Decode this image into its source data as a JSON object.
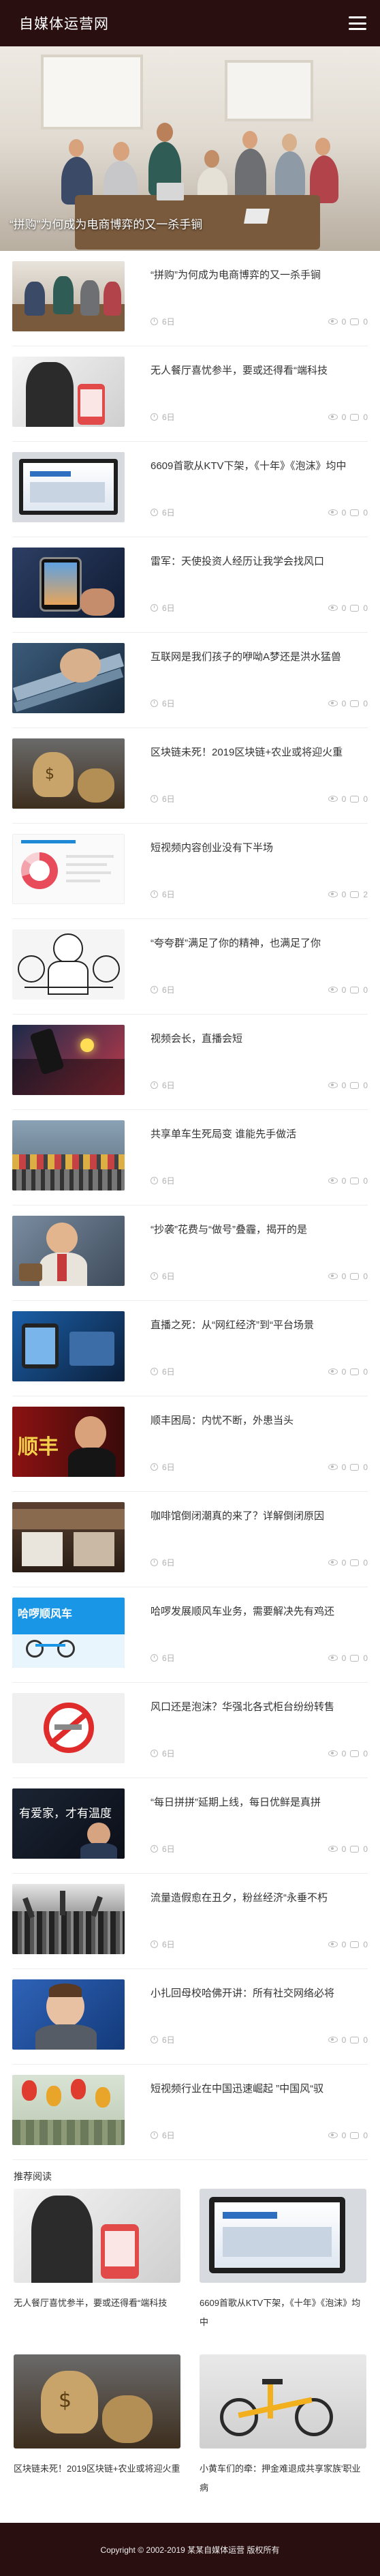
{
  "header": {
    "site_title": "自媒体运营网"
  },
  "hero": {
    "caption": "“拼购”为何成为电商博弈的又一杀手锏"
  },
  "articles": [
    {
      "title": "“拼购”为何成为电商博弈的又一杀手锏",
      "time": "6日",
      "views": "0",
      "comments": "0"
    },
    {
      "title": "无人餐厅喜忧参半，要或还得看“端科技",
      "time": "6日",
      "views": "0",
      "comments": "0"
    },
    {
      "title": "6609首歌从KTV下架，《十年》《泡沫》均中",
      "time": "6日",
      "views": "0",
      "comments": "0"
    },
    {
      "title": "雷军：天使投资人经历让我学会找风口",
      "time": "6日",
      "views": "0",
      "comments": "0"
    },
    {
      "title": "互联网是我们孩子的咿呦A梦还是洪水猛兽",
      "time": "6日",
      "views": "0",
      "comments": "0"
    },
    {
      "title": "区块链未死！2019区块链+农业或将迎火重",
      "time": "6日",
      "views": "0",
      "comments": "0"
    },
    {
      "title": "短视频内容创业没有下半场",
      "time": "6日",
      "views": "0",
      "comments": "2"
    },
    {
      "title": "“夸夸群”满足了你的精神，也满足了你",
      "time": "6日",
      "views": "0",
      "comments": "0"
    },
    {
      "title": "视频会长，直播会短",
      "time": "6日",
      "views": "0",
      "comments": "0"
    },
    {
      "title": "共享单车生死局变 谁能先手做活",
      "time": "6日",
      "views": "0",
      "comments": "0"
    },
    {
      "title": "“抄袭”花费与“做号”叠霾，揭开的是",
      "time": "6日",
      "views": "0",
      "comments": "0"
    },
    {
      "title": "直播之死：从“网红经济”到“平台场景",
      "time": "6日",
      "views": "0",
      "comments": "0"
    },
    {
      "title": "顺丰困局：内忧不断，外患当头",
      "time": "6日",
      "views": "0",
      "comments": "0"
    },
    {
      "title": "咖啡馆倒闭潮真的来了？详解倒闭原因",
      "time": "6日",
      "views": "0",
      "comments": "0"
    },
    {
      "title": "哈啰发展顺风车业务，需要解决先有鸡还",
      "time": "6日",
      "views": "0",
      "comments": "0"
    },
    {
      "title": "风口还是泡沫？华强北各式柜台纷纷转售",
      "time": "6日",
      "views": "0",
      "comments": "0"
    },
    {
      "title": "“每日拼拼”延期上线，每日优鲜是真拼",
      "time": "6日",
      "views": "0",
      "comments": "0"
    },
    {
      "title": "流量造假愈在丑夕，粉丝经济“永垂不朽",
      "time": "6日",
      "views": "0",
      "comments": "0"
    },
    {
      "title": "小扎回母校哈佛开讲：所有社交网络必将",
      "time": "6日",
      "views": "0",
      "comments": "0"
    },
    {
      "title": "短视频行业在中国迅速崛起 ”中国风“驭",
      "time": "6日",
      "views": "0",
      "comments": "0"
    }
  ],
  "recommend": {
    "heading": "推荐阅读",
    "items": [
      {
        "title": "无人餐厅喜忧参半，要或还得看“端科技"
      },
      {
        "title": "6609首歌从KTV下架，《十年》《泡沫》均中"
      },
      {
        "title": "区块链未死！2019区块链+农业或将迎火重"
      },
      {
        "title": "小黄车们的牵：押金难退成共享家族'职业病"
      }
    ]
  },
  "footer": {
    "copyright": "Copyright © 2002-2019 某某自媒体运营 版权所有"
  },
  "colors": {
    "header_bg": "#2a0f10",
    "meta_text": "#b0b0b0"
  },
  "icons": [
    "menu-icon",
    "clock-icon",
    "eye-icon",
    "comment-icon"
  ]
}
